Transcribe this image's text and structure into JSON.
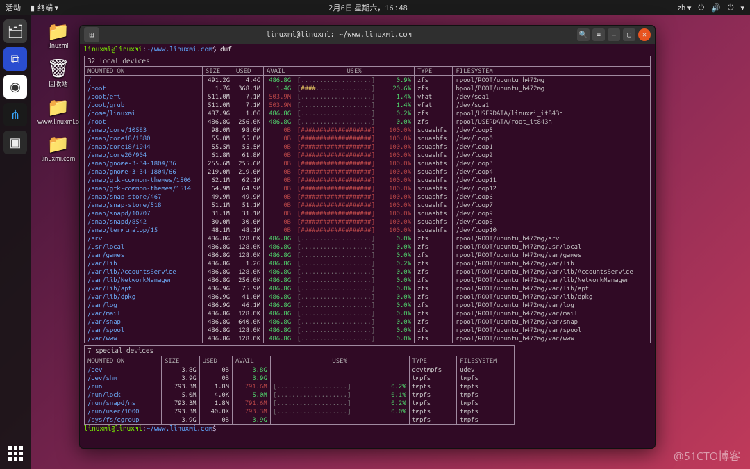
{
  "topbar": {
    "activities": "活动",
    "appmenu": "终端 ▾",
    "clock": "2月6日 星期六，16 : 48",
    "lang": "zh ▾"
  },
  "desktop_icons": [
    {
      "glyph": "📁",
      "label": "linuxmi"
    },
    {
      "glyph": "🗑",
      "label": "回收站"
    },
    {
      "glyph": "📁",
      "label": "www.linuxmi.com"
    },
    {
      "glyph": "📁",
      "label": "linuxmi.com"
    }
  ],
  "window": {
    "title": "linuxmi@linuxmi: ~/www.linuxmi.com",
    "prompt_user": "linuxmi@linuxmi",
    "prompt_path": "~/www.linuxmi.com",
    "prompt_sep": "$",
    "command": "duf"
  },
  "local_title": "32 local devices",
  "local_headers": [
    "MOUNTED ON",
    "SIZE",
    "USED",
    "AVAIL",
    "USE%",
    "TYPE",
    "FILESYSTEM"
  ],
  "local_rows": [
    {
      "m": "/",
      "s": "491.2G",
      "u": "4.4G",
      "a": "486.8G",
      "bar": "[...................]",
      "pct": "0.9%",
      "t": "zfs",
      "fs": "rpool/ROOT/ubuntu_h472mg"
    },
    {
      "m": "/boot",
      "s": "1.7G",
      "u": "368.1M",
      "a": "1.4G",
      "bar": "[####...............]",
      "pct": "20.6%",
      "t": "zfs",
      "fs": "bpool/BOOT/ubuntu_h472mg"
    },
    {
      "m": "/boot/efi",
      "s": "511.0M",
      "u": "7.1M",
      "a": "503.9M",
      "bar": "[...................]",
      "pct": "1.4%",
      "t": "vfat",
      "fs": "/dev/sda1",
      "az": true
    },
    {
      "m": "/boot/grub",
      "s": "511.0M",
      "u": "7.1M",
      "a": "503.9M",
      "bar": "[...................]",
      "pct": "1.4%",
      "t": "vfat",
      "fs": "/dev/sda1",
      "az": true
    },
    {
      "m": "/home/linuxmi",
      "s": "487.9G",
      "u": "1.0G",
      "a": "486.8G",
      "bar": "[...................]",
      "pct": "0.2%",
      "t": "zfs",
      "fs": "rpool/USERDATA/linuxmi_it843h"
    },
    {
      "m": "/root",
      "s": "486.8G",
      "u": "256.0K",
      "a": "486.8G",
      "bar": "[...................]",
      "pct": "0.0%",
      "t": "zfs",
      "fs": "rpool/USERDATA/root_it843h"
    },
    {
      "m": "/snap/core/10583",
      "s": "98.0M",
      "u": "98.0M",
      "a": "0B",
      "bar": "[###################]",
      "pct": "100.0%",
      "t": "squashfs",
      "fs": "/dev/loop5",
      "full": true
    },
    {
      "m": "/snap/core18/1880",
      "s": "55.0M",
      "u": "55.0M",
      "a": "0B",
      "bar": "[###################]",
      "pct": "100.0%",
      "t": "squashfs",
      "fs": "/dev/loop0",
      "full": true
    },
    {
      "m": "/snap/core18/1944",
      "s": "55.5M",
      "u": "55.5M",
      "a": "0B",
      "bar": "[###################]",
      "pct": "100.0%",
      "t": "squashfs",
      "fs": "/dev/loop1",
      "full": true
    },
    {
      "m": "/snap/core20/904",
      "s": "61.8M",
      "u": "61.8M",
      "a": "0B",
      "bar": "[###################]",
      "pct": "100.0%",
      "t": "squashfs",
      "fs": "/dev/loop2",
      "full": true
    },
    {
      "m": "/snap/gnome-3-34-1804/36",
      "s": "255.6M",
      "u": "255.6M",
      "a": "0B",
      "bar": "[###################]",
      "pct": "100.0%",
      "t": "squashfs",
      "fs": "/dev/loop3",
      "full": true
    },
    {
      "m": "/snap/gnome-3-34-1804/66",
      "s": "219.0M",
      "u": "219.0M",
      "a": "0B",
      "bar": "[###################]",
      "pct": "100.0%",
      "t": "squashfs",
      "fs": "/dev/loop4",
      "full": true
    },
    {
      "m": "/snap/gtk-common-themes/1506",
      "s": "62.1M",
      "u": "62.1M",
      "a": "0B",
      "bar": "[###################]",
      "pct": "100.0%",
      "t": "squashfs",
      "fs": "/dev/loop11",
      "full": true
    },
    {
      "m": "/snap/gtk-common-themes/1514",
      "s": "64.9M",
      "u": "64.9M",
      "a": "0B",
      "bar": "[###################]",
      "pct": "100.0%",
      "t": "squashfs",
      "fs": "/dev/loop12",
      "full": true
    },
    {
      "m": "/snap/snap-store/467",
      "s": "49.9M",
      "u": "49.9M",
      "a": "0B",
      "bar": "[###################]",
      "pct": "100.0%",
      "t": "squashfs",
      "fs": "/dev/loop6",
      "full": true
    },
    {
      "m": "/snap/snap-store/518",
      "s": "51.1M",
      "u": "51.1M",
      "a": "0B",
      "bar": "[###################]",
      "pct": "100.0%",
      "t": "squashfs",
      "fs": "/dev/loop7",
      "full": true
    },
    {
      "m": "/snap/snapd/10707",
      "s": "31.1M",
      "u": "31.1M",
      "a": "0B",
      "bar": "[###################]",
      "pct": "100.0%",
      "t": "squashfs",
      "fs": "/dev/loop9",
      "full": true
    },
    {
      "m": "/snap/snapd/8542",
      "s": "30.0M",
      "u": "30.0M",
      "a": "0B",
      "bar": "[###################]",
      "pct": "100.0%",
      "t": "squashfs",
      "fs": "/dev/loop8",
      "full": true
    },
    {
      "m": "/snap/terminalpp/15",
      "s": "48.1M",
      "u": "48.1M",
      "a": "0B",
      "bar": "[###################]",
      "pct": "100.0%",
      "t": "squashfs",
      "fs": "/dev/loop10",
      "full": true
    },
    {
      "m": "/srv",
      "s": "486.8G",
      "u": "128.0K",
      "a": "486.8G",
      "bar": "[...................]",
      "pct": "0.0%",
      "t": "zfs",
      "fs": "rpool/ROOT/ubuntu_h472mg/srv"
    },
    {
      "m": "/usr/local",
      "s": "486.8G",
      "u": "128.0K",
      "a": "486.8G",
      "bar": "[...................]",
      "pct": "0.0%",
      "t": "zfs",
      "fs": "rpool/ROOT/ubuntu_h472mg/usr/local"
    },
    {
      "m": "/var/games",
      "s": "486.8G",
      "u": "128.0K",
      "a": "486.8G",
      "bar": "[...................]",
      "pct": "0.0%",
      "t": "zfs",
      "fs": "rpool/ROOT/ubuntu_h472mg/var/games"
    },
    {
      "m": "/var/lib",
      "s": "486.8G",
      "u": "1.2G",
      "a": "486.8G",
      "bar": "[...................]",
      "pct": "0.2%",
      "t": "zfs",
      "fs": "rpool/ROOT/ubuntu_h472mg/var/lib"
    },
    {
      "m": "/var/lib/AccountsService",
      "s": "486.8G",
      "u": "128.0K",
      "a": "486.8G",
      "bar": "[...................]",
      "pct": "0.0%",
      "t": "zfs",
      "fs": "rpool/ROOT/ubuntu_h472mg/var/lib/AccountsService"
    },
    {
      "m": "/var/lib/NetworkManager",
      "s": "486.8G",
      "u": "256.0K",
      "a": "486.8G",
      "bar": "[...................]",
      "pct": "0.0%",
      "t": "zfs",
      "fs": "rpool/ROOT/ubuntu_h472mg/var/lib/NetworkManager"
    },
    {
      "m": "/var/lib/apt",
      "s": "486.9G",
      "u": "75.9M",
      "a": "486.8G",
      "bar": "[...................]",
      "pct": "0.0%",
      "t": "zfs",
      "fs": "rpool/ROOT/ubuntu_h472mg/var/lib/apt"
    },
    {
      "m": "/var/lib/dpkg",
      "s": "486.9G",
      "u": "41.0M",
      "a": "486.8G",
      "bar": "[...................]",
      "pct": "0.0%",
      "t": "zfs",
      "fs": "rpool/ROOT/ubuntu_h472mg/var/lib/dpkg"
    },
    {
      "m": "/var/log",
      "s": "486.9G",
      "u": "46.1M",
      "a": "486.8G",
      "bar": "[...................]",
      "pct": "0.0%",
      "t": "zfs",
      "fs": "rpool/ROOT/ubuntu_h472mg/var/log"
    },
    {
      "m": "/var/mail",
      "s": "486.8G",
      "u": "128.0K",
      "a": "486.8G",
      "bar": "[...................]",
      "pct": "0.0%",
      "t": "zfs",
      "fs": "rpool/ROOT/ubuntu_h472mg/var/mail"
    },
    {
      "m": "/var/snap",
      "s": "486.8G",
      "u": "640.0K",
      "a": "486.8G",
      "bar": "[...................]",
      "pct": "0.0%",
      "t": "zfs",
      "fs": "rpool/ROOT/ubuntu_h472mg/var/snap"
    },
    {
      "m": "/var/spool",
      "s": "486.8G",
      "u": "128.0K",
      "a": "486.8G",
      "bar": "[...................]",
      "pct": "0.0%",
      "t": "zfs",
      "fs": "rpool/ROOT/ubuntu_h472mg/var/spool"
    },
    {
      "m": "/var/www",
      "s": "486.8G",
      "u": "128.0K",
      "a": "486.8G",
      "bar": "[...................]",
      "pct": "0.0%",
      "t": "zfs",
      "fs": "rpool/ROOT/ubuntu_h472mg/var/www"
    }
  ],
  "special_title": "7 special devices",
  "special_headers": [
    "MOUNTED ON",
    "SIZE",
    "USED",
    "AVAIL",
    "USE%",
    "TYPE",
    "FILESYSTEM"
  ],
  "special_rows": [
    {
      "m": "/dev",
      "s": "3.8G",
      "u": "0B",
      "a": "3.8G",
      "bar": "",
      "pct": "",
      "t": "devtmpfs",
      "fs": "udev"
    },
    {
      "m": "/dev/shm",
      "s": "3.9G",
      "u": "0B",
      "a": "3.9G",
      "bar": "",
      "pct": "",
      "t": "tmpfs",
      "fs": "tmpfs"
    },
    {
      "m": "/run",
      "s": "793.3M",
      "u": "1.8M",
      "a": "791.6M",
      "bar": "[...................]",
      "pct": "0.2%",
      "t": "tmpfs",
      "fs": "tmpfs",
      "az": true
    },
    {
      "m": "/run/lock",
      "s": "5.0M",
      "u": "4.0K",
      "a": "5.0M",
      "bar": "[...................]",
      "pct": "0.1%",
      "t": "tmpfs",
      "fs": "tmpfs"
    },
    {
      "m": "/run/snapd/ns",
      "s": "793.3M",
      "u": "1.8M",
      "a": "791.6M",
      "bar": "[...................]",
      "pct": "0.2%",
      "t": "tmpfs",
      "fs": "tmpfs",
      "az": true
    },
    {
      "m": "/run/user/1000",
      "s": "793.3M",
      "u": "40.0K",
      "a": "793.3M",
      "bar": "[...................]",
      "pct": "0.0%",
      "t": "tmpfs",
      "fs": "tmpfs",
      "az": true
    },
    {
      "m": "/sys/fs/cgroup",
      "s": "3.9G",
      "u": "0B",
      "a": "3.9G",
      "bar": "",
      "pct": "",
      "t": "tmpfs",
      "fs": "tmpfs"
    }
  ],
  "watermark": "@51CTO博客"
}
